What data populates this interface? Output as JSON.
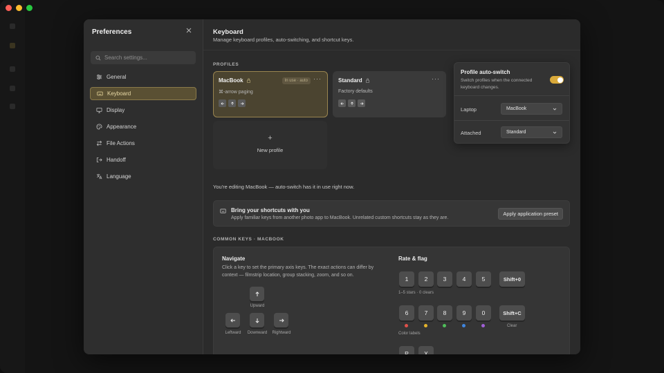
{
  "window": {
    "traffic_colors": [
      "#ff5f57",
      "#febc2e",
      "#28c840"
    ]
  },
  "sidebar": {
    "title": "Preferences",
    "close_icon": "close-icon",
    "search_placeholder": "Search settings...",
    "items": [
      {
        "label": "General",
        "icon": "sliders-icon"
      },
      {
        "label": "Keyboard",
        "icon": "keyboard-icon",
        "active": true
      },
      {
        "label": "Display",
        "icon": "monitor-icon"
      },
      {
        "label": "Appearance",
        "icon": "palette-icon"
      },
      {
        "label": "File Actions",
        "icon": "arrows-swap-icon"
      },
      {
        "label": "Handoff",
        "icon": "export-icon"
      },
      {
        "label": "Language",
        "icon": "translate-icon"
      }
    ]
  },
  "header": {
    "title": "Keyboard",
    "subtitle": "Manage keyboard profiles, auto-switching, and shortcut keys."
  },
  "profiles": {
    "section_label": "PROFILES",
    "cards": [
      {
        "name": "MacBook",
        "badge": "In use · auto",
        "description": "⌘-arrow paging",
        "active": true
      },
      {
        "name": "Standard",
        "badge": "",
        "description": "Factory defaults",
        "active": false
      }
    ],
    "more_glyph": "···",
    "new_profile_plus": "+",
    "new_profile_label": "New profile"
  },
  "autoswitch": {
    "title": "Profile auto-switch",
    "description": "Switch profiles when the connected keyboard changes.",
    "enabled": true,
    "rows": [
      {
        "label": "Laptop",
        "value": "MacBook"
      },
      {
        "label": "Attached",
        "value": "Standard"
      }
    ]
  },
  "status_text": "You're editing MacBook — auto-switch has it in use right now.",
  "banner": {
    "title": "Bring your shortcuts with you",
    "description": "Apply familiar keys from another photo app to MacBook. Unrelated custom shortcuts stay as they are.",
    "button": "Apply application preset"
  },
  "common_keys": {
    "section_label": "COMMON KEYS · MACBOOK",
    "navigate": {
      "title": "Navigate",
      "description": "Click a key to set the primary axis keys. The exact actions can differ by context — filmstrip location, group stacking, zoom, and so on.",
      "labels": {
        "up": "Upward",
        "left": "Leftward",
        "down": "Downward",
        "right": "Rightward"
      }
    },
    "rate_flag": {
      "title": "Rate & flag",
      "stars": [
        "1",
        "2",
        "3",
        "4",
        "5"
      ],
      "stars_wide": "Shift+0",
      "stars_note": "1–5 stars · 0 clears",
      "colors": [
        "6",
        "7",
        "8",
        "9",
        "0"
      ],
      "colors_wide": "Shift+C",
      "clear_label": "Clear",
      "color_dots": [
        "#e0504a",
        "#e6b42b",
        "#4fbf5a",
        "#3f86e0",
        "#a05fd6"
      ],
      "color_note": "Color labels",
      "flags": [
        "P",
        "X"
      ]
    }
  },
  "colors": {
    "accent": "#d9a93a",
    "active_bg": "#4b4430",
    "active_border": "#9a8550"
  }
}
